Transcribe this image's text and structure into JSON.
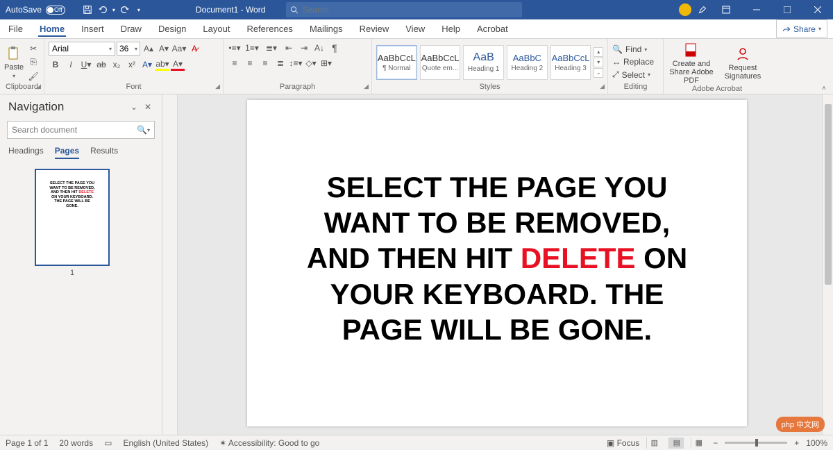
{
  "titlebar": {
    "autosave_label": "AutoSave",
    "autosave_state": "Off",
    "doc_title": "Document1 - Word",
    "search_placeholder": "Search"
  },
  "ribbon_tabs": [
    "File",
    "Home",
    "Insert",
    "Draw",
    "Design",
    "Layout",
    "References",
    "Mailings",
    "Review",
    "View",
    "Help",
    "Acrobat"
  ],
  "ribbon_active_tab": "Home",
  "share_label": "Share",
  "font": {
    "name": "Arial",
    "size": "36"
  },
  "groups": {
    "clipboard": "Clipboard",
    "font": "Font",
    "paragraph": "Paragraph",
    "styles": "Styles",
    "editing": "Editing",
    "adobe": "Adobe Acrobat"
  },
  "clipboard_paste": "Paste",
  "styles": [
    {
      "preview": "AaBbCcL",
      "name": "¶ Normal",
      "sel": true,
      "blue": false
    },
    {
      "preview": "AaBbCcL",
      "name": "Quote em...",
      "sel": false,
      "blue": false
    },
    {
      "preview": "AaB",
      "name": "Heading 1",
      "sel": false,
      "blue": true
    },
    {
      "preview": "AaBbC",
      "name": "Heading 2",
      "sel": false,
      "blue": true
    },
    {
      "preview": "AaBbCcL",
      "name": "Heading 3",
      "sel": false,
      "blue": true
    }
  ],
  "editing": {
    "find": "Find",
    "replace": "Replace",
    "select": "Select"
  },
  "adobe": {
    "create": "Create and Share Adobe PDF",
    "request": "Request Signatures"
  },
  "navpane": {
    "title": "Navigation",
    "search_placeholder": "Search document",
    "tabs": [
      "Headings",
      "Pages",
      "Results"
    ],
    "active_tab": "Pages",
    "thumb_lines": [
      "SELECT THE PAGE YOU",
      "WANT TO BE REMOVED,",
      "AND THEN HIT ",
      "DELETE",
      "ON YOUR KEYBOARD.",
      "THE PAGE WILL BE",
      "GONE."
    ],
    "thumb_number": "1"
  },
  "document": {
    "line1": "SELECT THE PAGE YOU WANT TO BE REMOVED, AND THEN HIT ",
    "delete_word": "DELETE",
    "line2": " ON YOUR KEYBOARD. THE PAGE WILL BE GONE."
  },
  "statusbar": {
    "page": "Page 1 of 1",
    "words": "20 words",
    "lang": "English (United States)",
    "accessibility": "Accessibility: Good to go",
    "focus": "Focus",
    "zoom": "100%"
  },
  "watermark": "中文网"
}
